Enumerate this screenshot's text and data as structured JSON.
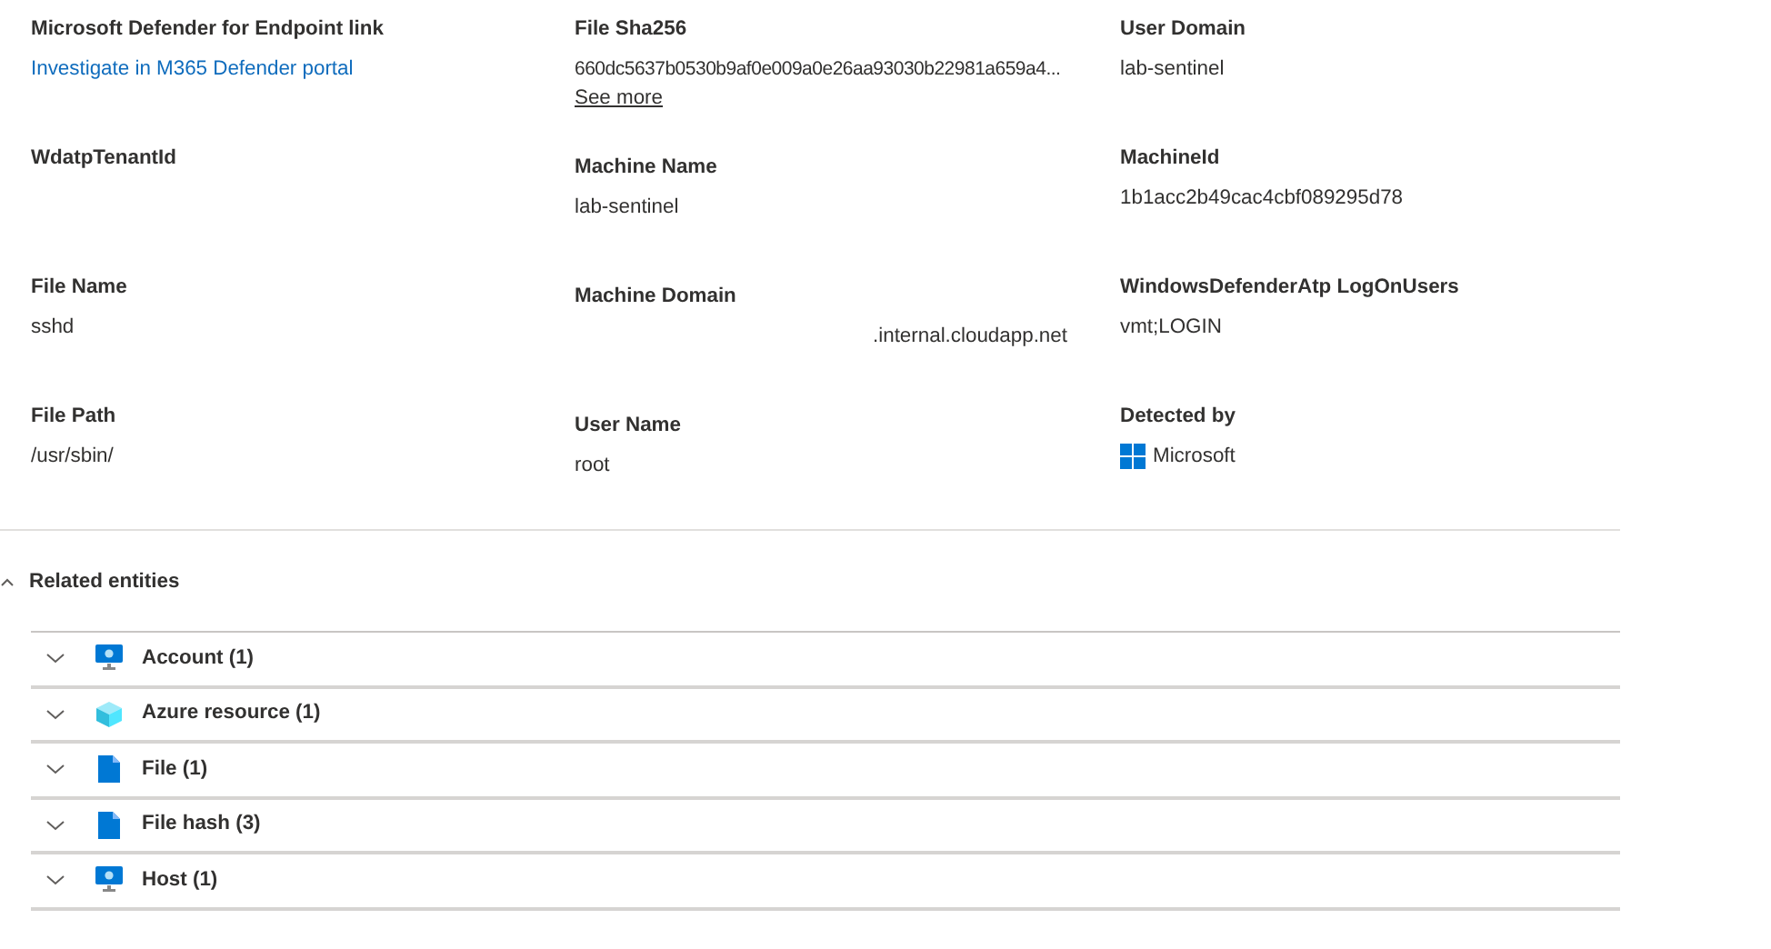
{
  "fields": [
    {
      "label": "Microsoft Defender for Endpoint link",
      "value": "Investigate in M365 Defender portal",
      "kind": "link"
    },
    {
      "label": "File Sha256",
      "value": "660dc5637b0530b9af0e009a0e26aa93030b22981a659a4...",
      "more": "See more",
      "kind": "text"
    },
    {
      "label": "User Domain",
      "value": "lab-sentinel",
      "kind": "text"
    },
    {
      "label": "WdatpTenantId"
    },
    {
      "label": "Machine Name",
      "value": "lab-sentinel",
      "kind": "text"
    },
    {
      "label": "MachineId",
      "value": "1b1acc2b49cac4cbf089295d78",
      "kind": "text"
    },
    {
      "label": "File Name",
      "value": "sshd",
      "kind": "text"
    },
    {
      "label": "Machine Domain",
      "value": ".internal.cloudapp.net",
      "kind": "masked"
    },
    {
      "label": "WindowsDefenderAtp LogOnUsers",
      "value": "vmt;LOGIN",
      "kind": "text"
    },
    {
      "label": "File Path",
      "value": "/usr/sbin/",
      "kind": "text"
    },
    {
      "label": "User Name",
      "value": "root",
      "kind": "text"
    },
    {
      "label": "Detected by",
      "value": "Microsoft",
      "kind": "vendor"
    }
  ],
  "related": {
    "title": "Related entities",
    "expanded": true,
    "items": [
      {
        "label": "Account (1)",
        "kind": "monitor",
        "expanded": false
      },
      {
        "label": "Azure resource (1)",
        "kind": "cube",
        "expanded": false
      },
      {
        "label": "File (1)",
        "kind": "file",
        "expanded": false
      },
      {
        "label": "File hash (3)",
        "kind": "file",
        "expanded": false
      },
      {
        "label": "Host (1)",
        "kind": "monitor",
        "expanded": false
      }
    ]
  }
}
